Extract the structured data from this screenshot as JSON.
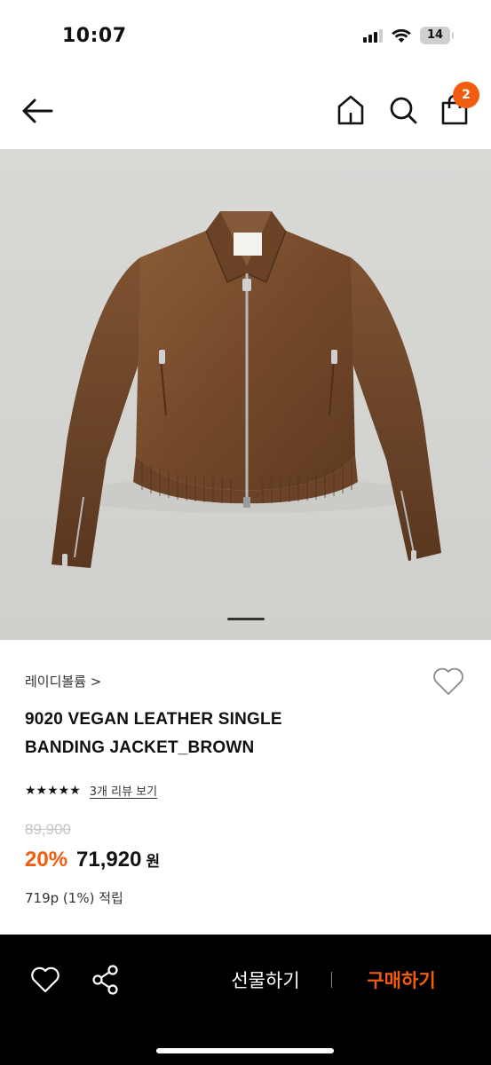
{
  "status": {
    "time": "10:07",
    "battery": "14"
  },
  "header": {
    "back_icon": "arrow-left-icon",
    "home_icon": "home-icon",
    "search_icon": "search-icon",
    "cart_icon": "shopping-bag-icon",
    "cart_count": "2"
  },
  "product": {
    "image_alt": "brown vegan leather banding jacket",
    "carousel_icon": "carousel-indicator",
    "brand": "레이디볼륨 >",
    "name_line1": "9020 VEGAN LEATHER SINGLE",
    "name_line2": "BANDING JACKET_BROWN",
    "stars": "★★★★★",
    "review_link": "3개 리뷰 보기",
    "original_price": "89,900",
    "discount": "20%",
    "sale_price": "71,920",
    "currency": "원",
    "points": "719p (1%) 적립"
  },
  "bottom_bar": {
    "gift_label": "선물하기",
    "buy_label": "구매하기"
  },
  "colors": {
    "accent": "#f25c0f",
    "bottom_bar_bg": "#000000",
    "jacket": "#7a4f2e"
  }
}
